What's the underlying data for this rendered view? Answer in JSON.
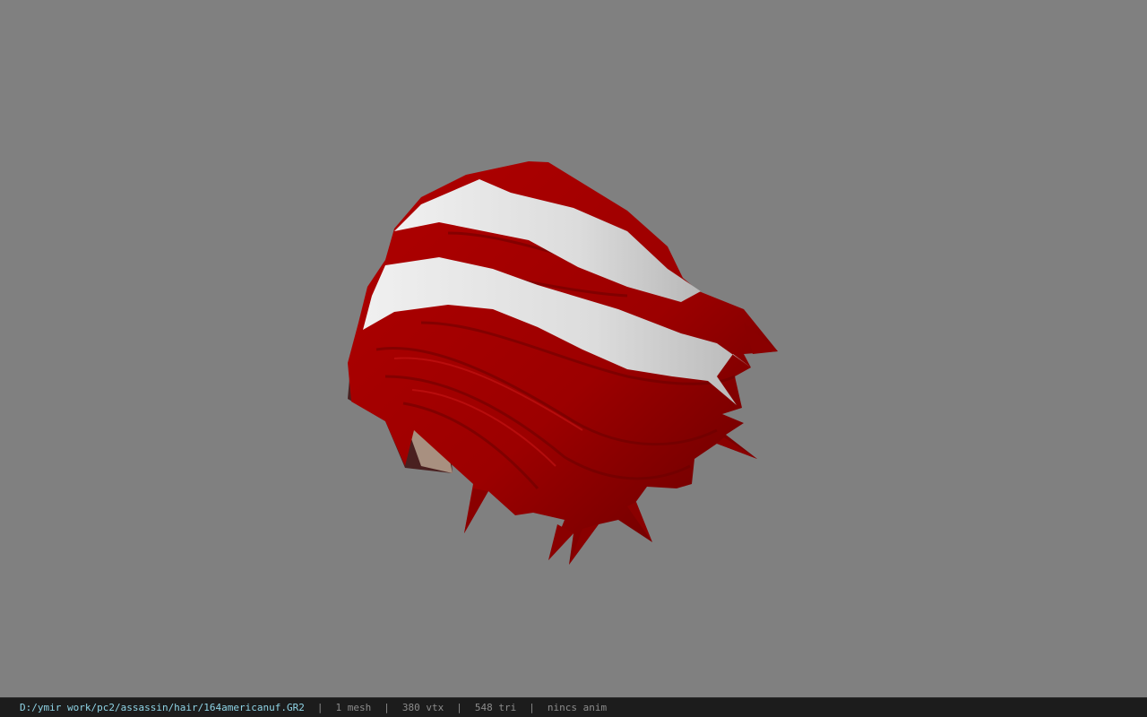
{
  "status": {
    "file_path": "D:/ymir work/pc2/assassin/hair/164americanuf.GR2",
    "separator": "|",
    "mesh_count": "1 mesh",
    "vertex_count": "380 vtx",
    "triangle_count": "548 tri",
    "animation": "nincs anim"
  },
  "colors": {
    "background": "#808080",
    "hair_red": "#a80000",
    "hair_red_dark": "#6a0000",
    "stripe_white": "#e4e4e4",
    "statusbar_bg": "#1c1c1c",
    "path_text": "#8fd4e6"
  }
}
